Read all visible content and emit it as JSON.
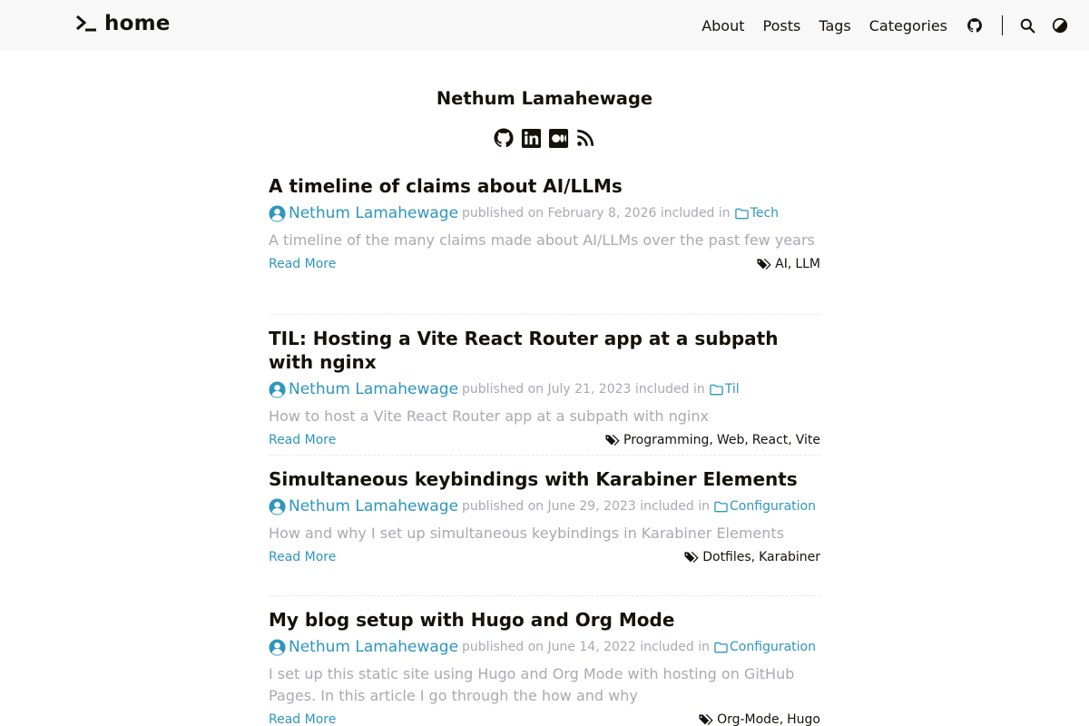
{
  "header": {
    "logo_text": "home",
    "nav": [
      "About",
      "Posts",
      "Tags",
      "Categories"
    ]
  },
  "profile": {
    "name": "Nethum Lamahewage"
  },
  "colors": {
    "accent": "#2d96bd",
    "text": "#161209",
    "muted": "#a9a9b3",
    "header_bg": "#f8f8f8"
  },
  "posts": [
    {
      "title": "A timeline of claims about AI/LLMs",
      "author": "Nethum Lamahewage",
      "meta": "published on February 8, 2026 included in",
      "category": "Tech",
      "summary": "A timeline of the many claims made about AI/LLMs over the past few years",
      "read_more": "Read More",
      "tags": [
        "AI",
        "LLM"
      ]
    },
    {
      "title": "TIL: Hosting a Vite React Router app at a subpath with nginx",
      "author": "Nethum Lamahewage",
      "meta": "published on July 21, 2023 included in",
      "category": "Til",
      "summary": "How to host a Vite React Router app at a subpath with nginx",
      "read_more": "Read More",
      "tags": [
        "Programming",
        "Web",
        "React",
        "Vite"
      ]
    },
    {
      "title": "Simultaneous keybindings with Karabiner Elements",
      "author": "Nethum Lamahewage",
      "meta": "published on June 29, 2023 included in",
      "category": "Configuration",
      "summary": "How and why I set up simultaneous keybindings in Karabiner Elements",
      "read_more": "Read More",
      "tags": [
        "Dotfiles",
        "Karabiner"
      ]
    },
    {
      "title": "My blog setup with Hugo and Org Mode",
      "author": "Nethum Lamahewage",
      "meta": "published on June 14, 2022 included in",
      "category": "Configuration",
      "summary": "I set up this static site using Hugo and Org Mode with hosting on GitHub Pages. In this article I go through the how and why",
      "read_more": "Read More",
      "tags": [
        "Org-Mode",
        "Hugo"
      ]
    }
  ]
}
